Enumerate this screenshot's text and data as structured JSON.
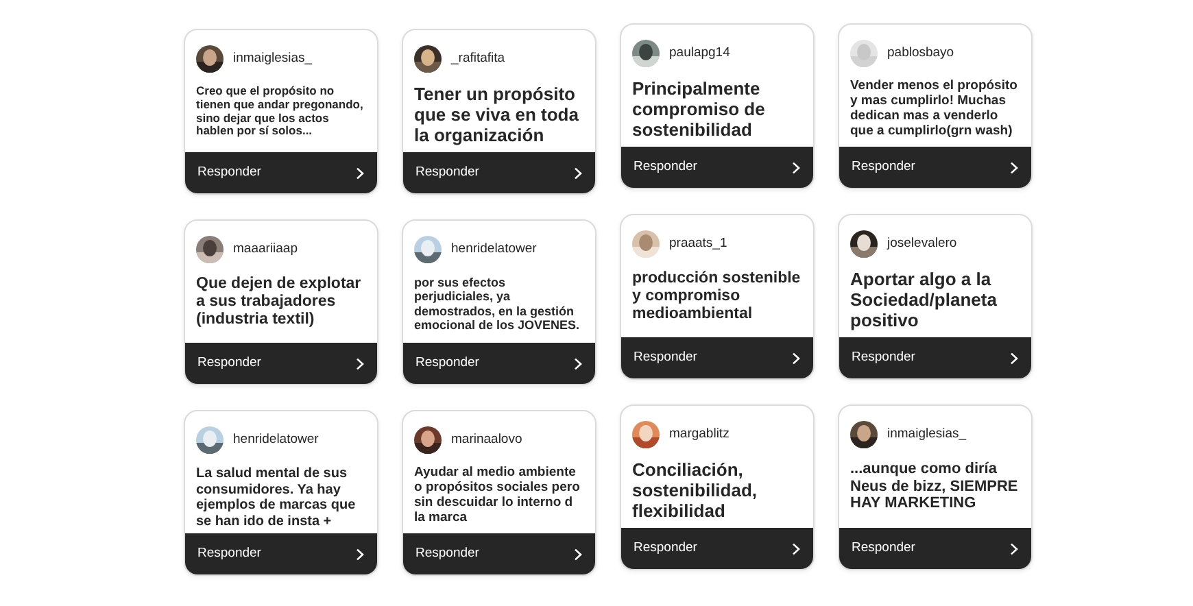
{
  "cards": [
    {
      "username": "inmaiglesias_",
      "answer": "Creo que el propósito no tienen que andar pregonando, sino dejar que los actos hablen por sí solos...",
      "button": "Responder"
    },
    {
      "username": "_rafitafita",
      "answer": "Tener un propósito que se viva en toda la organización",
      "button": "Responder"
    },
    {
      "username": "paulapg14",
      "answer": "Principalmente compromiso de sostenibilidad",
      "button": "Responder"
    },
    {
      "username": "pablosbayo",
      "answer": "Vender menos el propósito y mas cumplirlo! Muchas dedican mas a venderlo que a cumplirlo(grn wash)",
      "button": "Responder"
    },
    {
      "username": "maaariiaap",
      "answer": "Que dejen de explotar a sus trabajadores (industria textil)",
      "button": "Responder"
    },
    {
      "username": "henridelatower",
      "answer": "por sus efectos perjudiciales, ya demostrados, en la gestión emocional de los JOVENES.",
      "button": "Responder"
    },
    {
      "username": "praaats_1",
      "answer": "producción sostenible y compromiso medioambiental",
      "button": "Responder"
    },
    {
      "username": "joselevalero",
      "answer": "Aportar algo a la Sociedad/planeta positivo",
      "button": "Responder"
    },
    {
      "username": "henridelatower",
      "answer": "La salud mental de sus consumidores. Ya hay ejemplos de marcas que se han ido de insta +",
      "button": "Responder"
    },
    {
      "username": "marinaalovo",
      "answer": "Ayudar al medio ambiente o propósitos sociales pero sin descuidar lo interno d la marca",
      "button": "Responder"
    },
    {
      "username": "margablitz",
      "answer": "Conciliación, sostenibilidad, flexibilidad",
      "button": "Responder"
    },
    {
      "username": "inmaiglesias_",
      "answer": "...aunque como diría Neus de bizz, SIEMPRE HAY MARKETING",
      "button": "Responder"
    }
  ]
}
